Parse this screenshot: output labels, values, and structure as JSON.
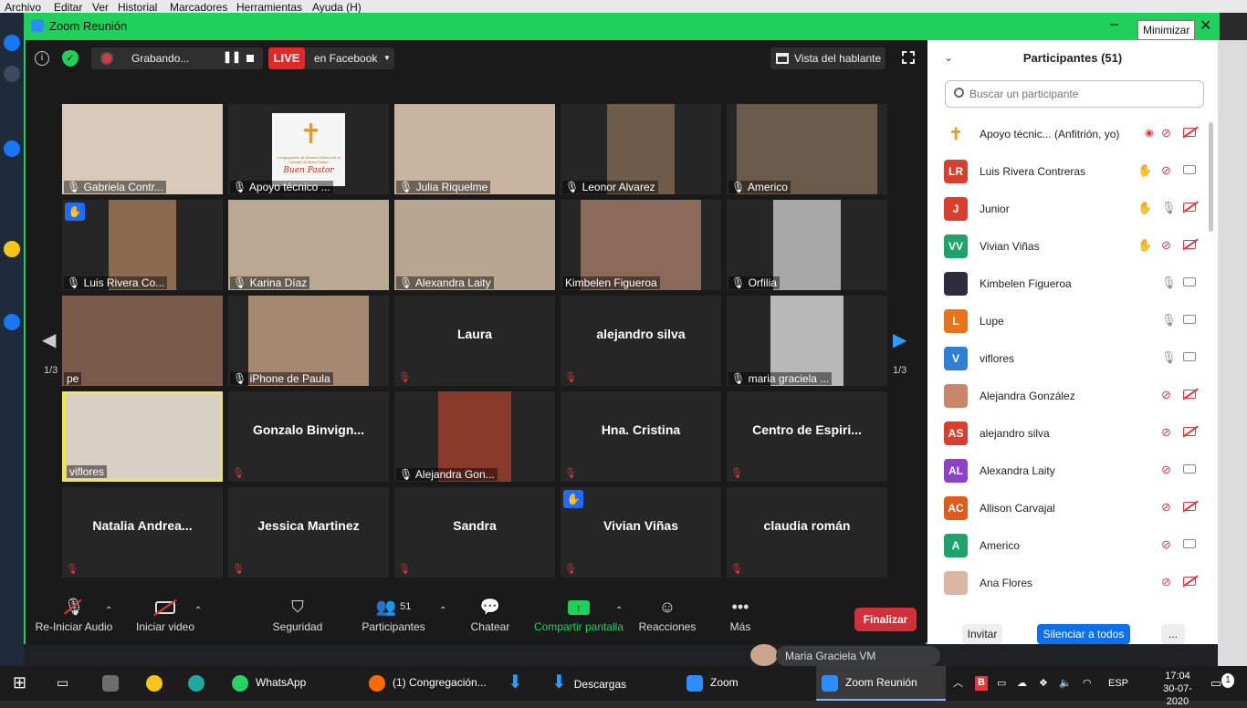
{
  "bg_menu": [
    "Archivo",
    "Editar",
    "Ver",
    "Historial",
    "Marcadores",
    "Herramientas",
    "Ayuda (H)"
  ],
  "window": {
    "title": "Zoom Reunión",
    "tooltip": "Minimizar"
  },
  "topbar": {
    "recording": "Grabando...",
    "live": "LIVE",
    "destination": "en Facebook",
    "view": "Vista del hablante"
  },
  "page_indicator": {
    "left": "1/3",
    "right": "1/3"
  },
  "tiles": [
    {
      "name": "Gabriela Contr...",
      "type": "video",
      "muted": true
    },
    {
      "name": "Apoyo técnico ...",
      "type": "logo",
      "muted": true,
      "logo_text": "Congregación de Nuestra Señora de la Caridad del Buen Pastor",
      "logo_name": "Buen Pastor"
    },
    {
      "name": "Julia Riquelme",
      "type": "video",
      "muted": true
    },
    {
      "name": "Leonor Alvarez",
      "type": "video",
      "muted": true
    },
    {
      "name": "Americo",
      "type": "video",
      "muted": true
    },
    {
      "name": "Luis Rivera Co...",
      "type": "video",
      "muted": true,
      "hand": true
    },
    {
      "name": "Karina Díaz",
      "type": "video",
      "muted": true
    },
    {
      "name": "Alexandra  Laity",
      "type": "video",
      "muted": true
    },
    {
      "name": "Kimbelen Figueroa",
      "type": "video",
      "muted": false
    },
    {
      "name": "Orfilia",
      "type": "video",
      "muted": true
    },
    {
      "name": "pe",
      "type": "video",
      "muted": false
    },
    {
      "name": "iPhone de Paula",
      "type": "video",
      "muted": true
    },
    {
      "name": "Laura",
      "type": "name",
      "muted": true
    },
    {
      "name": "alejandro silva",
      "type": "name",
      "muted": true
    },
    {
      "name": "maria graciela ...",
      "type": "video",
      "muted": true
    },
    {
      "name": "viflores",
      "type": "video",
      "muted": false,
      "active": true
    },
    {
      "name": "Gonzalo  Binvign...",
      "type": "name",
      "muted": true
    },
    {
      "name": "Alejandra Gon...",
      "type": "video",
      "muted": true
    },
    {
      "name": "Hna. Cristina",
      "type": "name",
      "muted": true
    },
    {
      "name": "Centro  de  Espiri...",
      "type": "name",
      "muted": true
    },
    {
      "name": "Natalia  Andrea...",
      "type": "name",
      "muted": true
    },
    {
      "name": "Jessica Martinez",
      "type": "name",
      "muted": true
    },
    {
      "name": "Sandra",
      "type": "name",
      "muted": true
    },
    {
      "name": "Vivian Viñas",
      "type": "name",
      "muted": true,
      "hand": true
    },
    {
      "name": "claudia román",
      "type": "name",
      "muted": true
    }
  ],
  "toolbar": {
    "audio": "Re-Iniciar Audio",
    "video": "Iniciar video",
    "security": "Seguridad",
    "participants": "Participantes",
    "participants_count": "51",
    "chat": "Chatear",
    "share": "Compartir pantalla",
    "reactions": "Reacciones",
    "more": "Más",
    "end": "Finalizar"
  },
  "panel": {
    "title": "Participantes (51)",
    "search_placeholder": "Buscar un participante",
    "participants": [
      {
        "name": "Apoyo técnic...   (Anfitrión, yo)",
        "initials": "",
        "color": "#ffffff",
        "hand": false,
        "mic": "muted",
        "cam": "off",
        "record": true
      },
      {
        "name": "Luis Rivera Contreras",
        "initials": "LR",
        "color": "#d93f2e",
        "hand": true,
        "mic": "muted",
        "cam": "on"
      },
      {
        "name": "Junior",
        "initials": "J",
        "color": "#d93f2e",
        "hand": true,
        "mic": "on",
        "cam": "off"
      },
      {
        "name": "Vivian Viñas",
        "initials": "VV",
        "color": "#1fa36a",
        "hand": true,
        "mic": "muted",
        "cam": "off"
      },
      {
        "name": "Kimbelen Figueroa",
        "initials": "",
        "color": "#2c2c3a",
        "hand": false,
        "mic": "on",
        "cam": "on"
      },
      {
        "name": "Lupe",
        "initials": "L",
        "color": "#e8731a",
        "hand": false,
        "mic": "on",
        "cam": "on"
      },
      {
        "name": "viflores",
        "initials": "V",
        "color": "#2f7fd6",
        "hand": false,
        "mic": "on",
        "cam": "on"
      },
      {
        "name": "Alejandra González",
        "initials": "",
        "color": "#c9866a",
        "hand": false,
        "mic": "muted",
        "cam": "off"
      },
      {
        "name": "alejandro silva",
        "initials": "AS",
        "color": "#d93f2e",
        "hand": false,
        "mic": "muted",
        "cam": "off"
      },
      {
        "name": "Alexandra  Laity",
        "initials": "AL",
        "color": "#8a43c9",
        "hand": false,
        "mic": "muted",
        "cam": "on"
      },
      {
        "name": "Allison Carvajal",
        "initials": "AC",
        "color": "#e05a1c",
        "hand": false,
        "mic": "muted",
        "cam": "off"
      },
      {
        "name": "Americo",
        "initials": "A",
        "color": "#1fa36a",
        "hand": false,
        "mic": "muted",
        "cam": "on"
      },
      {
        "name": "Ana Flores",
        "initials": "",
        "color": "#d9b7a3",
        "hand": false,
        "mic": "muted",
        "cam": "off"
      }
    ],
    "invite": "Invitar",
    "mute_all": "Silenciar a todos",
    "more": "..."
  },
  "bg_chat": {
    "name": "Maria Graciela VM"
  },
  "taskbar": {
    "items": [
      "WhatsApp",
      "(1) Congregación...",
      "Descargas",
      "Zoom",
      "Zoom Reunión"
    ],
    "lang": "ESP",
    "time": "17:04",
    "date": "30-07-2020",
    "notifications": "1"
  }
}
